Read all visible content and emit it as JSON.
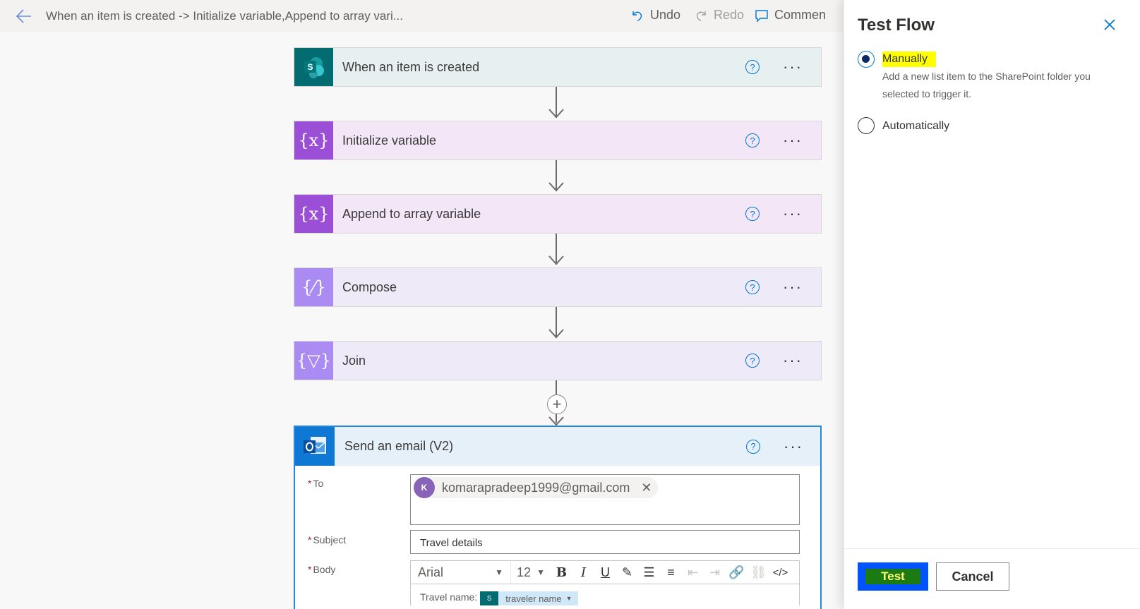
{
  "header": {
    "flow_title": "When an item is created -> Initialize variable,Append to array vari...",
    "undo_label": "Undo",
    "redo_label": "Redo",
    "comments_label": "Commen"
  },
  "steps": [
    {
      "title": "When an item is created",
      "icon": "sharepoint-icon",
      "icon_glyph": "S",
      "color": "#036c70",
      "bg": "#e6f0f0"
    },
    {
      "title": "Initialize variable",
      "icon": "variable-icon",
      "icon_glyph": "{x}",
      "color": "#9b4fd6",
      "bg": "#f2e6f7"
    },
    {
      "title": "Append to array variable",
      "icon": "variable-icon",
      "icon_glyph": "{x}",
      "color": "#9b4fd6",
      "bg": "#f2e6f7"
    },
    {
      "title": "Compose",
      "icon": "compose-icon",
      "icon_glyph": "{⁄}",
      "color": "#a98bf1",
      "bg": "#eeeaf8"
    },
    {
      "title": "Join",
      "icon": "join-icon",
      "icon_glyph": "{▽}",
      "color": "#a98bf1",
      "bg": "#eeeaf8"
    }
  ],
  "email_step": {
    "title": "Send an email (V2)",
    "icon": "outlook-icon",
    "to_label": "To",
    "to_avatar": "K",
    "to_value": "komarapradeep1999@gmail.com",
    "subject_label": "Subject",
    "subject_value": "Travel details",
    "body_label": "Body",
    "font_value": "Arial",
    "size_value": "12",
    "body_text": "Travel name:",
    "body_token": "traveler name"
  },
  "panel": {
    "title": "Test Flow",
    "option_manual": "Manually",
    "option_manual_desc": "Add a new list item to the SharePoint folder you selected to trigger it.",
    "option_auto": "Automatically",
    "test_label": "Test",
    "cancel_label": "Cancel",
    "selected_option": "Manually"
  },
  "colors": {
    "accent": "#0078d4",
    "highlight": "#ffff00",
    "test_button": "#0053ff"
  }
}
